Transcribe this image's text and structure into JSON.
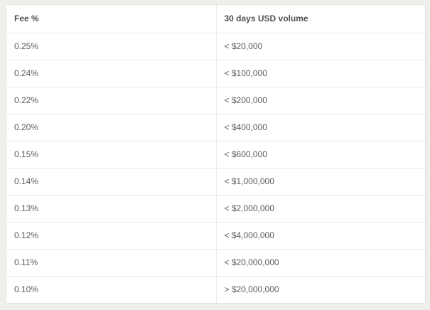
{
  "fee_table": {
    "headers": {
      "fee": "Fee %",
      "volume": "30 days USD volume"
    },
    "rows": [
      {
        "fee": "0.25%",
        "volume": "< $20,000"
      },
      {
        "fee": "0.24%",
        "volume": "< $100,000"
      },
      {
        "fee": "0.22%",
        "volume": "< $200,000"
      },
      {
        "fee": "0.20%",
        "volume": "< $400,000"
      },
      {
        "fee": "0.15%",
        "volume": "< $600,000"
      },
      {
        "fee": "0.14%",
        "volume": "< $1,000,000"
      },
      {
        "fee": "0.13%",
        "volume": "< $2,000,000"
      },
      {
        "fee": "0.12%",
        "volume": "< $4,000,000"
      },
      {
        "fee": "0.11%",
        "volume": "< $20,000,000"
      },
      {
        "fee": "0.10%",
        "volume": "> $20,000,000"
      }
    ]
  }
}
